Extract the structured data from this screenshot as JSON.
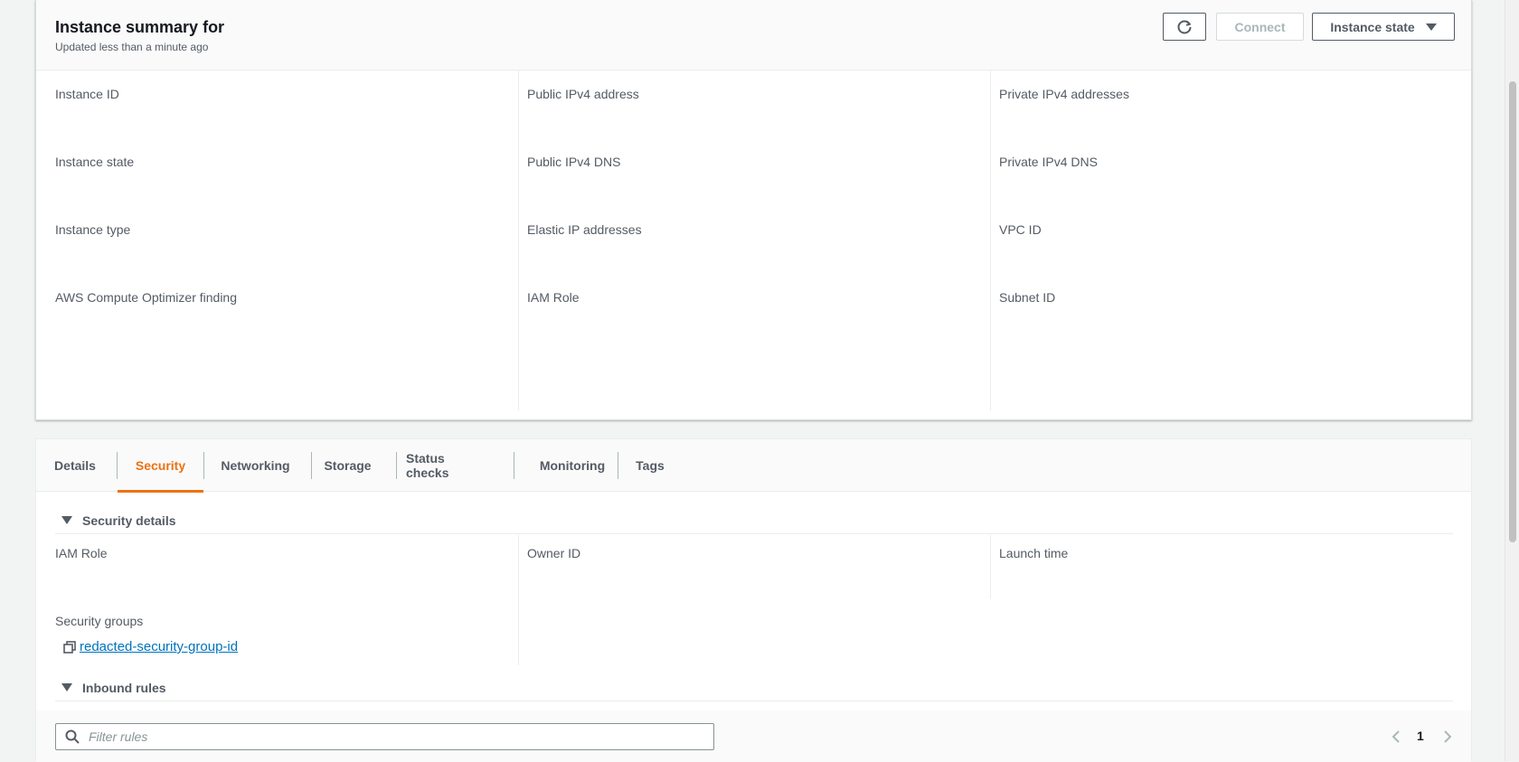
{
  "summary": {
    "title": "Instance summary for",
    "updated": "Updated less than a minute ago",
    "buttons": {
      "connect": "Connect",
      "instance_state": "Instance state"
    },
    "fields": {
      "col1": [
        "Instance ID",
        "Instance state",
        "Instance type",
        "AWS Compute Optimizer finding"
      ],
      "col2": [
        "Public IPv4 address",
        "Public IPv4 DNS",
        "Elastic IP addresses",
        "IAM Role"
      ],
      "col3": [
        "Private IPv4 addresses",
        "Private IPv4 DNS",
        "VPC ID",
        "Subnet ID"
      ]
    }
  },
  "tabs": [
    {
      "label": "Details",
      "active": false
    },
    {
      "label": "Security",
      "active": true
    },
    {
      "label": "Networking",
      "active": false
    },
    {
      "label": "Storage",
      "active": false
    },
    {
      "label": "Status checks",
      "active": false
    },
    {
      "label": "Monitoring",
      "active": false
    },
    {
      "label": "Tags",
      "active": false
    }
  ],
  "security": {
    "section_title": "Security details",
    "iam_role_label": "IAM Role",
    "owner_id_label": "Owner ID",
    "launch_time_label": "Launch time",
    "security_groups_label": "Security groups",
    "security_group_link": "redacted-security-group-id"
  },
  "inbound": {
    "section_title": "Inbound rules",
    "filter_placeholder": "Filter rules",
    "page_number": "1"
  },
  "colors": {
    "accent": "#ec7211",
    "link": "#0073bb",
    "text_secondary": "#545b64"
  }
}
